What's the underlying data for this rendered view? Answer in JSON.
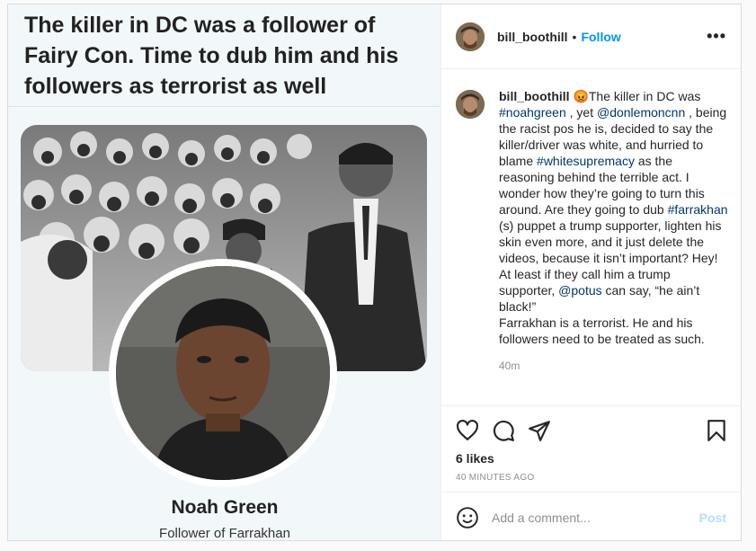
{
  "meme": {
    "title": "The killer in DC was a follower of Fairy Con. Time to dub him and his followers as terrorist as well",
    "name": "Noah Green",
    "subtitle": "Follower of Farrakhan"
  },
  "header": {
    "username": "bill_boothill",
    "separator": "•",
    "follow_label": "Follow",
    "more_label": "•••"
  },
  "caption": {
    "username": "bill_boothill",
    "emoji": "😡",
    "segments": [
      {
        "text": "The killer in DC was ",
        "tag": false
      },
      {
        "text": "#noahgreen",
        "tag": true
      },
      {
        "text": " , yet ",
        "tag": false
      },
      {
        "text": "@donlemoncnn",
        "tag": true
      },
      {
        "text": " , being the racist pos he is, decided to say the killer/driver was white, and hurried to blame ",
        "tag": false
      },
      {
        "text": "#whitesupremacy",
        "tag": true
      },
      {
        "text": " as the reasoning behind the terrible act. I wonder how they’re going to turn this around. Are they going to dub ",
        "tag": false
      },
      {
        "text": "#farrakhan",
        "tag": true
      },
      {
        "text": " (s) puppet a trump supporter, lighten his skin even more, and it just delete the videos, because it isn’t important? Hey! At least if they call him a trump supporter, ",
        "tag": false
      },
      {
        "text": "@potus",
        "tag": true
      },
      {
        "text": " can say, “he ain’t black!”",
        "tag": false
      }
    ],
    "last_line": "Farrakhan is a terrorist. He and his followers need to be treated as such.",
    "time_ago": "40m"
  },
  "actions": {
    "likes": "6 likes",
    "posted": "40 MINUTES AGO"
  },
  "comment": {
    "placeholder": "Add a comment...",
    "post_label": "Post"
  },
  "colors": {
    "accent": "#0095f6",
    "tag": "#00376b",
    "post_disabled": "#b2dffc"
  }
}
